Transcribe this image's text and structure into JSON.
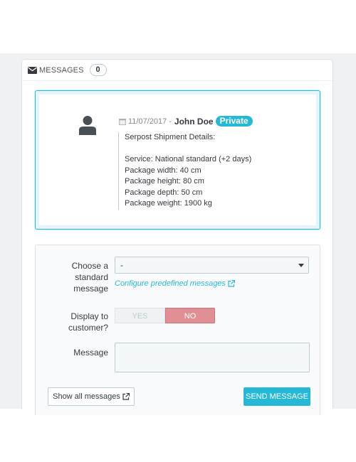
{
  "panel": {
    "title": "MESSAGES",
    "count": "0"
  },
  "message": {
    "date": "11/07/2017",
    "separator": "-",
    "author": "John Doe",
    "badge": "Private",
    "lines": [
      "Serpost Shipment Details:",
      "",
      "Service: National standard (+2 days)",
      "Package width: 40 cm",
      "Package height: 80 cm",
      "Package depth: 50 cm",
      "Package weight: 1900 kg"
    ]
  },
  "form": {
    "standard_label": [
      "Choose a",
      "standard",
      "message"
    ],
    "select_value": "-",
    "configure_link": "Configure predefined messages",
    "display_label": [
      "Display to",
      "customer?"
    ],
    "toggle_yes": "YES",
    "toggle_no": "NO",
    "toggle_selected": "NO",
    "message_label": "Message",
    "message_value": "",
    "show_all": "Show all messages",
    "send": "SEND MESSAGE"
  },
  "colors": {
    "accent": "#25b9d7",
    "danger": "#e08f95"
  },
  "icons": [
    "envelope-icon",
    "user-icon",
    "calendar-icon",
    "external-link-icon"
  ]
}
